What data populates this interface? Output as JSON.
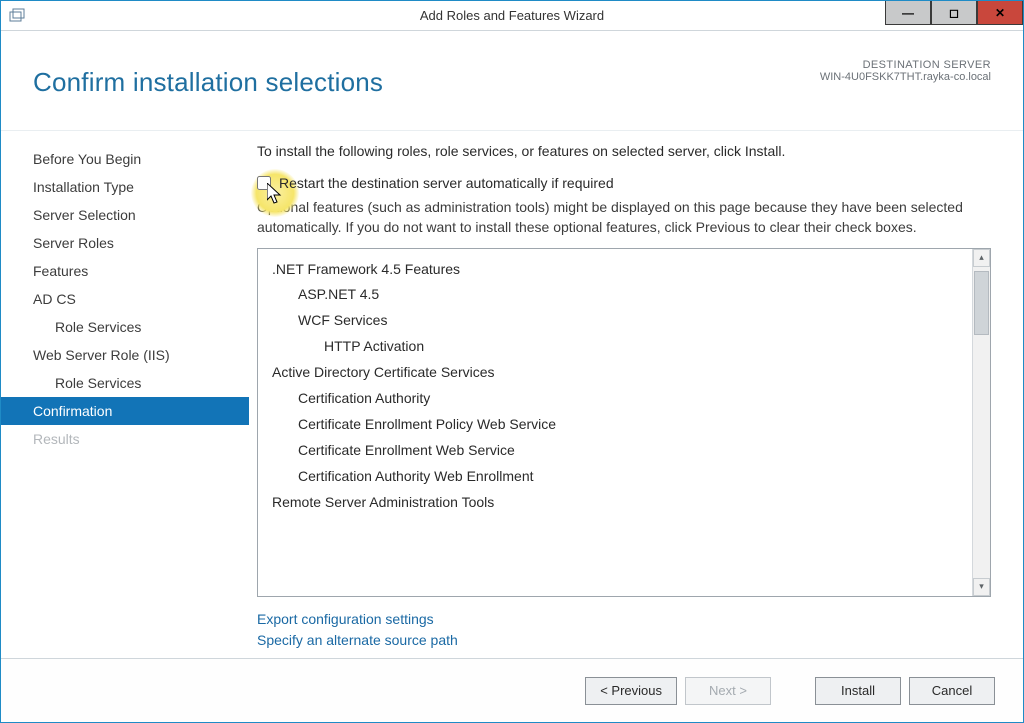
{
  "window": {
    "title": "Add Roles and Features Wizard"
  },
  "header": {
    "title": "Confirm installation selections",
    "dest_label": "DESTINATION SERVER",
    "dest_server": "WIN-4U0FSKK7THT.rayka-co.local"
  },
  "nav": {
    "items": [
      {
        "label": "Before You Begin",
        "selected": false,
        "sub": false,
        "disabled": false
      },
      {
        "label": "Installation Type",
        "selected": false,
        "sub": false,
        "disabled": false
      },
      {
        "label": "Server Selection",
        "selected": false,
        "sub": false,
        "disabled": false
      },
      {
        "label": "Server Roles",
        "selected": false,
        "sub": false,
        "disabled": false
      },
      {
        "label": "Features",
        "selected": false,
        "sub": false,
        "disabled": false
      },
      {
        "label": "AD CS",
        "selected": false,
        "sub": false,
        "disabled": false
      },
      {
        "label": "Role Services",
        "selected": false,
        "sub": true,
        "disabled": false
      },
      {
        "label": "Web Server Role (IIS)",
        "selected": false,
        "sub": false,
        "disabled": false
      },
      {
        "label": "Role Services",
        "selected": false,
        "sub": true,
        "disabled": false
      },
      {
        "label": "Confirmation",
        "selected": true,
        "sub": false,
        "disabled": false
      },
      {
        "label": "Results",
        "selected": false,
        "sub": false,
        "disabled": true
      }
    ]
  },
  "content": {
    "intro": "To install the following roles, role services, or features on selected server, click Install.",
    "restart_label": "Restart the destination server automatically if required",
    "restart_checked": false,
    "note": "Optional features (such as administration tools) might be displayed on this page because they have been selected automatically. If you do not want to install these optional features, click Previous to clear their check boxes.",
    "features": [
      {
        "label": ".NET Framework 4.5 Features",
        "level": 0
      },
      {
        "label": "ASP.NET 4.5",
        "level": 1
      },
      {
        "label": "WCF Services",
        "level": 1
      },
      {
        "label": "HTTP Activation",
        "level": 2
      },
      {
        "label": "Active Directory Certificate Services",
        "level": 0
      },
      {
        "label": "Certification Authority",
        "level": 1
      },
      {
        "label": "Certificate Enrollment Policy Web Service",
        "level": 1
      },
      {
        "label": "Certificate Enrollment Web Service",
        "level": 1
      },
      {
        "label": "Certification Authority Web Enrollment",
        "level": 1
      },
      {
        "label": "Remote Server Administration Tools",
        "level": 0
      }
    ],
    "link_export": "Export configuration settings",
    "link_source": "Specify an alternate source path"
  },
  "footer": {
    "previous": "< Previous",
    "next": "Next >",
    "install": "Install",
    "cancel": "Cancel"
  }
}
